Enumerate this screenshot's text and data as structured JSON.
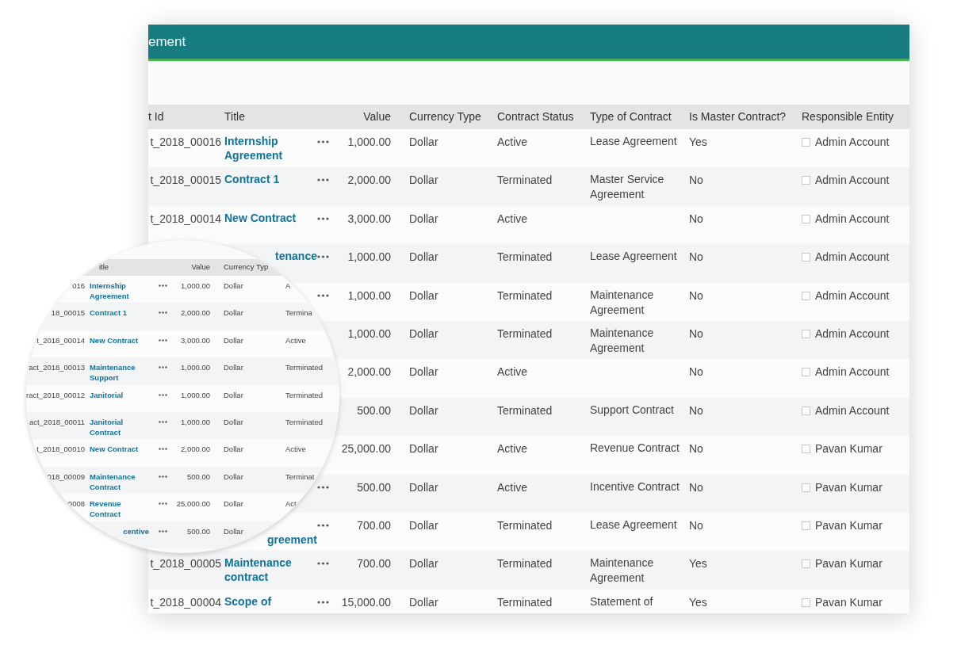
{
  "window": {
    "title": "ement"
  },
  "table": {
    "columns": [
      "t Id",
      "Title",
      "Value",
      "Currency Type",
      "Contract Status",
      "Type of Contract",
      "Is Master Contract?",
      "Responsible Entity"
    ],
    "rows": [
      {
        "id": "t_2018_00016",
        "title": "Internship Agreement",
        "menu": true,
        "value": "1,000.00",
        "currency": "Dollar",
        "status": "Active",
        "type": "Lease Agreement",
        "master": "Yes",
        "entity": "Admin Account"
      },
      {
        "id": "t_2018_00015",
        "title": "Contract 1",
        "menu": true,
        "value": "2,000.00",
        "currency": "Dollar",
        "status": "Terminated",
        "type": "Master Service Agreement",
        "master": "No",
        "entity": "Admin Account"
      },
      {
        "id": "t_2018_00014",
        "title": "New Contract",
        "menu": true,
        "value": "3,000.00",
        "currency": "Dollar",
        "status": "Active",
        "master": "No",
        "entity": "Admin Account"
      },
      {
        "title": "tenance",
        "title_cut": true,
        "title_wrapped": false,
        "menu": true,
        "value": "1,000.00",
        "currency": "Dollar",
        "status": "Terminated",
        "type": "Lease Agreement",
        "master": "No",
        "entity": "Admin Account"
      },
      {
        "menu": true,
        "value": "1,000.00",
        "currency": "Dollar",
        "status": "Terminated",
        "type": "Maintenance Agreement",
        "master": "No",
        "entity": "Admin Account"
      },
      {
        "menu": false,
        "value": "1,000.00",
        "currency": "Dollar",
        "status": "Terminated",
        "type": "Maintenance Agreement",
        "master": "No",
        "entity": "Admin Account"
      },
      {
        "menu": false,
        "value": "2,000.00",
        "currency": "Dollar",
        "status": "Active",
        "master": "No",
        "entity": "Admin Account"
      },
      {
        "menu": false,
        "value": "500.00",
        "currency": "Dollar",
        "status": "Terminated",
        "type": "Support Contract",
        "master": "No",
        "entity": "Admin Account"
      },
      {
        "menu": false,
        "value": "25,000.00",
        "currency": "Dollar",
        "status": "Active",
        "type": "Revenue Contract",
        "master": "No",
        "entity": "Pavan Kumar"
      },
      {
        "menu": true,
        "value": "500.00",
        "currency": "Dollar",
        "status": "Active",
        "type": "Incentive Contract",
        "master": "No",
        "entity": "Pavan Kumar"
      },
      {
        "title": "greement",
        "title_cut": true,
        "title_wrapped": true,
        "menu": true,
        "value": "700.00",
        "currency": "Dollar",
        "status": "Terminated",
        "type": "Lease Agreement",
        "master": "No",
        "entity": "Pavan Kumar"
      },
      {
        "id": "t_2018_00005",
        "title": "Maintenance contract",
        "menu": true,
        "value": "700.00",
        "currency": "Dollar",
        "status": "Terminated",
        "type": "Maintenance Agreement",
        "master": "Yes",
        "entity": "Pavan Kumar"
      },
      {
        "id": "t_2018_00004",
        "title": "Scope of",
        "menu": true,
        "value": "15,000.00",
        "currency": "Dollar",
        "status": "Terminated",
        "type": "Statement of",
        "master": "Yes",
        "entity": "Pavan Kumar"
      }
    ]
  },
  "magnifier": {
    "columns": [
      "itle",
      "Value",
      "Currency Typ"
    ],
    "rows": [
      {
        "id": "016",
        "title": "Internship Agreement",
        "value": "1,000.00",
        "currency": "Dollar",
        "status": "A"
      },
      {
        "id": "18_00015",
        "title": "Contract 1",
        "value": "2,000.00",
        "currency": "Dollar",
        "status": "Termina"
      },
      {
        "id": "t_2018_00014",
        "title": "New Contract",
        "value": "3,000.00",
        "currency": "Dollar",
        "status": "Active"
      },
      {
        "id": "act_2018_00013",
        "title": "Maintenance Support",
        "value": "1,000.00",
        "currency": "Dollar",
        "status": "Terminated"
      },
      {
        "id": "ract_2018_00012",
        "title": "Janitorial",
        "value": "1,000.00",
        "currency": "Dollar",
        "status": "Terminated"
      },
      {
        "id": "act_2018_00011",
        "title": "Janitorial Contract",
        "value": "1,000.00",
        "currency": "Dollar",
        "status": "Terminated"
      },
      {
        "id": "t_2018_00010",
        "title": "New Contract",
        "value": "2,000.00",
        "currency": "Dollar",
        "status": "Active"
      },
      {
        "id": "018_00009",
        "title": "Maintenance Contract",
        "value": "500.00",
        "currency": "Dollar",
        "status": "Terminat"
      },
      {
        "id": "0008",
        "title": "Revenue Contract",
        "value": "25,000.00",
        "currency": "Dollar",
        "status": "Act"
      },
      {
        "title": "centive",
        "title_cut": true,
        "value": "500.00",
        "currency": "Dollar"
      }
    ]
  }
}
